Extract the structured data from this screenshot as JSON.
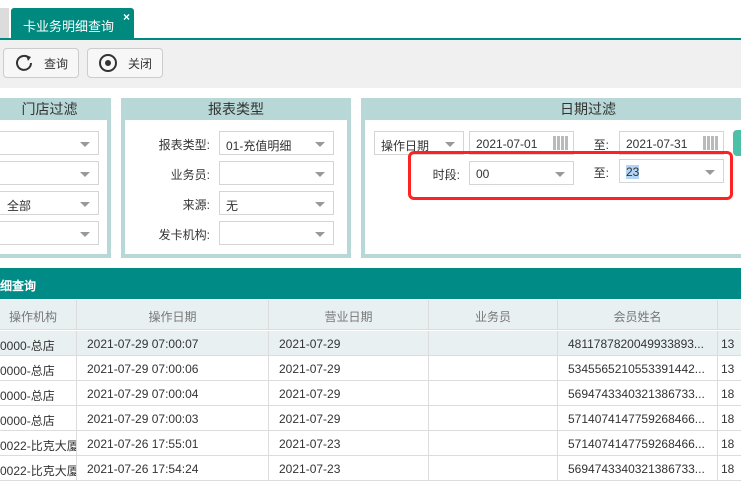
{
  "tab": {
    "title": "卡业务明细查询",
    "close": "×"
  },
  "toolbar": {
    "query": "查询",
    "close": "关闭"
  },
  "store_filter": {
    "title": "门店过滤",
    "values": [
      "",
      "",
      "全部",
      ""
    ]
  },
  "report_type": {
    "title": "报表类型",
    "fields": [
      {
        "label": "报表类型:",
        "value": "01-充值明细"
      },
      {
        "label": "业务员:",
        "value": ""
      },
      {
        "label": "来源:",
        "value": "无"
      },
      {
        "label": "发卡机构:",
        "value": ""
      }
    ]
  },
  "date_filter": {
    "title": "日期过滤",
    "date_type": "操作日期",
    "from": "2021-07-01",
    "to_label": "至:",
    "to": "2021-07-31",
    "period_label": "时段:",
    "period_from": "00",
    "period_to_label": "至:",
    "period_to": "23"
  },
  "grid": {
    "title": "细查询",
    "columns": [
      "操作机构",
      "操作日期",
      "营业日期",
      "业务员",
      "会员姓名",
      ""
    ],
    "rows": [
      [
        "0000-总店",
        "2021-07-29 07:00:07",
        "2021-07-29",
        "",
        "4811787820049933893...",
        "13"
      ],
      [
        "0000-总店",
        "2021-07-29 07:00:06",
        "2021-07-29",
        "",
        "5345565210553391442...",
        "13"
      ],
      [
        "0000-总店",
        "2021-07-29 07:00:04",
        "2021-07-29",
        "",
        "5694743340321386733...",
        "18"
      ],
      [
        "0000-总店",
        "2021-07-29 07:00:03",
        "2021-07-29",
        "",
        "5714074147759268466...",
        "18"
      ],
      [
        "0022-比克大厦",
        "2021-07-26 17:55:01",
        "2021-07-23",
        "",
        "5714074147759268466...",
        "18"
      ],
      [
        "0022-比克大厦",
        "2021-07-26 17:54:24",
        "2021-07-23",
        "",
        "5694743340321386733...",
        "18"
      ]
    ]
  },
  "colors": {
    "accent": "#00897f",
    "panel": "#b7d8d6",
    "highlight": "#ff2222"
  }
}
